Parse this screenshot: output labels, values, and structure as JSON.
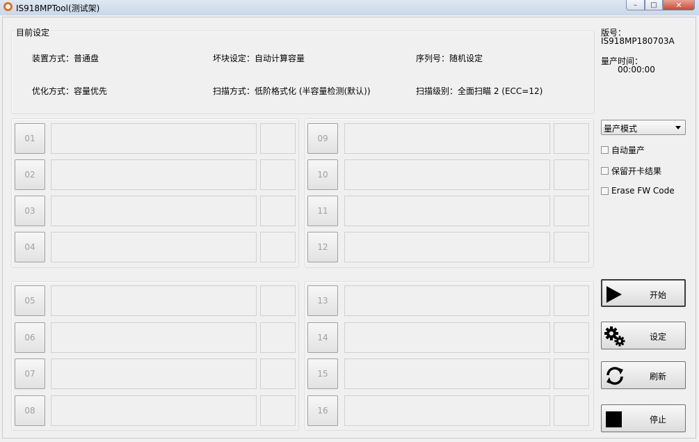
{
  "window": {
    "title": "IS918MPTool(测试架)"
  },
  "settings": {
    "title": "目前设定",
    "install_mode": "装置方式：普通盘",
    "optimize_mode": "优化方式：容量优先",
    "bad_block": "坏块设定：自动计算容量",
    "scan_mode": "扫描方式：低阶格式化 (半容量检测(默认))",
    "serial": "序列号：随机设定",
    "scan_level": "扫描级别：全面扫瞄 2 (ECC=12)"
  },
  "info": {
    "version_label": "版号：",
    "version_value": "IS918MP180703A",
    "time_label": "量产时间：",
    "time_value": "00:00:00"
  },
  "ports": [
    "01",
    "02",
    "03",
    "04",
    "05",
    "06",
    "07",
    "08",
    "09",
    "10",
    "11",
    "12",
    "13",
    "14",
    "15",
    "16"
  ],
  "mode_select": {
    "selected": "量产模式"
  },
  "options": {
    "auto_mp": "自动量产",
    "keep_result": "保留开卡结果",
    "erase_fw": "Erase FW Code"
  },
  "buttons": {
    "start": "开始",
    "settings": "设定",
    "refresh": "刷新",
    "stop": "停止"
  }
}
